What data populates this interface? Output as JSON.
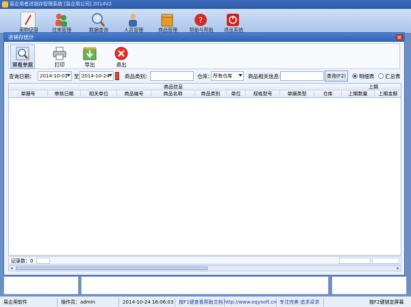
{
  "app": {
    "title": "易企用者进销存管理系统 [易企用公司] 2014V2",
    "toolbar": [
      {
        "label": "采购记录",
        "icon": "document-icon",
        "color": "#c7272b"
      },
      {
        "label": "往来管理",
        "icon": "people-icon",
        "color": "#2e8b3d"
      },
      {
        "label": "数据查询",
        "icon": "magnifier-icon",
        "color": "#6a8fc7"
      },
      {
        "label": "人员管理",
        "icon": "users-icon",
        "color": "#3c66b2"
      },
      {
        "label": "商品管理",
        "icon": "box-icon",
        "color": "#d48a1b"
      },
      {
        "label": "帮助与帮助",
        "icon": "help-icon",
        "color": "#d52a2a"
      },
      {
        "label": "退出系统",
        "icon": "power-icon",
        "color": "#d21d1d"
      }
    ]
  },
  "dialog": {
    "title": "进销存统计",
    "toolbar": {
      "view": "察看单据",
      "print": "打印",
      "export": "导出",
      "exit": "退出"
    },
    "filter": {
      "date_label": "查询日期：",
      "date_from": "2014-10-01",
      "to_label": "至",
      "date_to": "2014-10-24",
      "category_label": "商品类别：",
      "category_value": "",
      "warehouse_label": "仓库：",
      "warehouse_value": "所有仓库",
      "info_label": "商品相关信息：",
      "info_value": "",
      "query_button": "查询(F2)",
      "detail_radio": "明细表",
      "summary_radio": "汇总表"
    },
    "grid": {
      "group_goods": "商品信息",
      "group_prev": "上期",
      "columns": [
        "单据号",
        "审核日期",
        "相关单位",
        "商品编号",
        "商品名称",
        "商品类别",
        "单位",
        "规格型号",
        "单据类型",
        "仓库",
        "上期数量",
        "上期金额"
      ]
    },
    "footer": {
      "record_count": "记录数：0"
    }
  },
  "status": {
    "software": "易企用软件",
    "operator": "操作员：admin",
    "datetime": "2014-10-24 16:06:03",
    "help": "按F1键查看帮助文档",
    "url": "http://www.eqysoft.cn/",
    "slogan": "专注完美 追求卓求",
    "lock": "按F2键锁定屏幕"
  },
  "colors": {
    "title_blue": "#2f61b3",
    "desktop_blue": "#6d8fc4",
    "close_red": "#d84a3a"
  }
}
